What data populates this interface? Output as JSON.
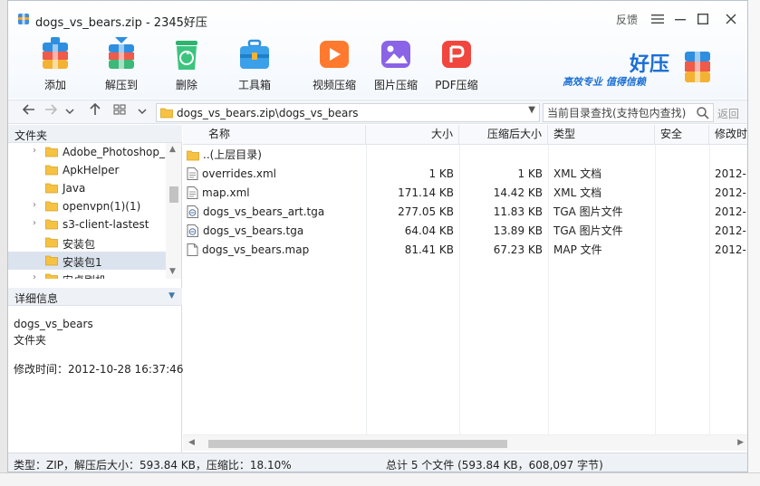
{
  "window": {
    "title": "dogs_vs_bears.zip - 2345好压",
    "feedback": "反馈",
    "menu_icon": "hamburger-icon",
    "minimize_icon": "minimize-icon",
    "maximize_icon": "maximize-icon",
    "close_icon": "close-icon"
  },
  "toolbar": {
    "add": "添加",
    "extract": "解压到",
    "delete": "删除",
    "toolbox": "工具箱",
    "video": "视频压缩",
    "image": "图片压缩",
    "pdf": "PDF压缩"
  },
  "brand": {
    "name": "好压",
    "slogan": "高效专业  值得信赖"
  },
  "nav": {
    "path": "dogs_vs_bears.zip\\dogs_vs_bears",
    "search_placeholder": "当前目录查找(支持包内查找)",
    "back_label": "返回"
  },
  "left_panel": {
    "folders_title": "文件夹",
    "tree": [
      {
        "name": "Adobe_Photoshop_",
        "expandable": true,
        "selected": false
      },
      {
        "name": "ApkHelper",
        "expandable": false,
        "selected": false
      },
      {
        "name": "Java",
        "expandable": false,
        "selected": false
      },
      {
        "name": "openvpn(1)(1)",
        "expandable": true,
        "selected": false
      },
      {
        "name": "s3-client-lastest",
        "expandable": true,
        "selected": false
      },
      {
        "name": "安装包",
        "expandable": false,
        "selected": false
      },
      {
        "name": "安装包1",
        "expandable": false,
        "selected": true
      },
      {
        "name": "安卓刷机",
        "expandable": true,
        "selected": false
      }
    ],
    "details_title": "详细信息",
    "details": {
      "name": "dogs_vs_bears",
      "type": "文件夹",
      "modified": "修改时间：2012-10-28 16:37:46"
    }
  },
  "file_list": {
    "columns": {
      "name": "名称",
      "size": "大小",
      "packed": "压缩后大小",
      "type": "类型",
      "security": "安全",
      "modified": "修改时"
    },
    "rows": [
      {
        "name": "..(上层目录)",
        "size": "",
        "packed": "",
        "type": "",
        "modified": "",
        "icon": "folder-icon"
      },
      {
        "name": "overrides.xml",
        "size": "1 KB",
        "packed": "1 KB",
        "type": "XML 文档",
        "modified": "2012-",
        "icon": "xml-file-icon"
      },
      {
        "name": "map.xml",
        "size": "171.14 KB",
        "packed": "14.42 KB",
        "type": "XML 文档",
        "modified": "2012-",
        "icon": "xml-file-icon"
      },
      {
        "name": "dogs_vs_bears_art.tga",
        "size": "277.05 KB",
        "packed": "11.83 KB",
        "type": "TGA 图片文件",
        "modified": "2012-",
        "icon": "image-file-icon"
      },
      {
        "name": "dogs_vs_bears.tga",
        "size": "64.04 KB",
        "packed": "13.89 KB",
        "type": "TGA 图片文件",
        "modified": "2012-",
        "icon": "image-file-icon"
      },
      {
        "name": "dogs_vs_bears.map",
        "size": "81.41 KB",
        "packed": "67.23 KB",
        "type": "MAP 文件",
        "modified": "2012-",
        "icon": "file-icon"
      }
    ]
  },
  "status": {
    "left": "类型：ZIP，解压后大小：593.84 KB，压缩比：18.10%",
    "right": "总计 5 个文件 (593.84 KB，608,097 字节)"
  },
  "colors": {
    "accent": "#1a6fd6",
    "folder": "#f6c244",
    "selection": "#dbe3ee"
  }
}
